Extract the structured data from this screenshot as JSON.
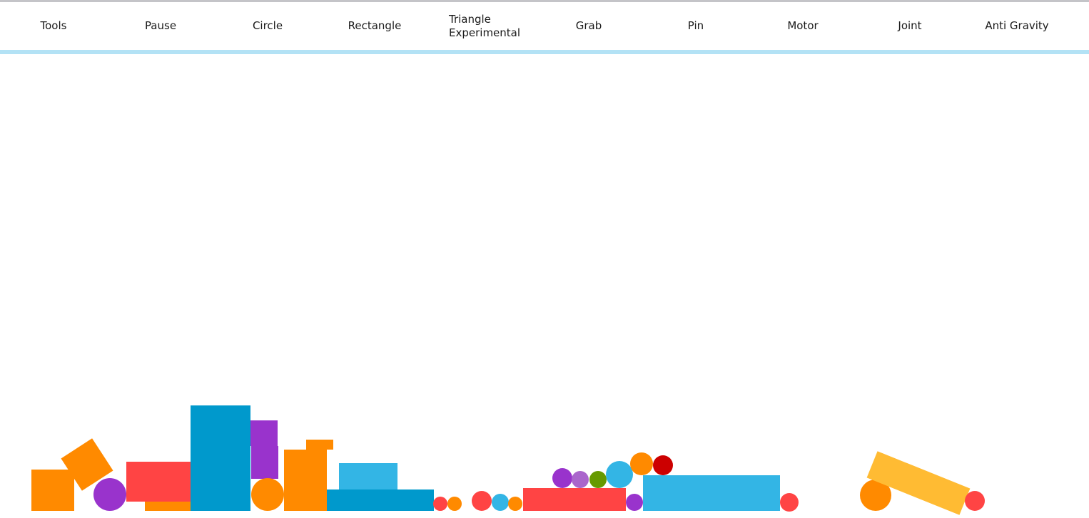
{
  "toolbar": {
    "tools": "Tools",
    "pause": "Pause",
    "circle": "Circle",
    "rectangle": "Rectangle",
    "triangle": "Triangle",
    "triangle_note": "Experimental",
    "grab": "Grab",
    "pin": "Pin",
    "motor": "Motor",
    "joint": "Joint",
    "anti_gravity": "Anti Gravity"
  },
  "colors": {
    "accent_bar": "#b3e2f5",
    "orange": "#ff8a00",
    "red": "#ff4444",
    "blue": "#0099cc",
    "light_blue": "#33b5e5",
    "purple": "#9933cc",
    "light_purple": "#aa66cc",
    "green": "#669900",
    "dark_red": "#cc0000",
    "yellow": "#ffbb33"
  },
  "scene": {
    "body_count": 34
  }
}
